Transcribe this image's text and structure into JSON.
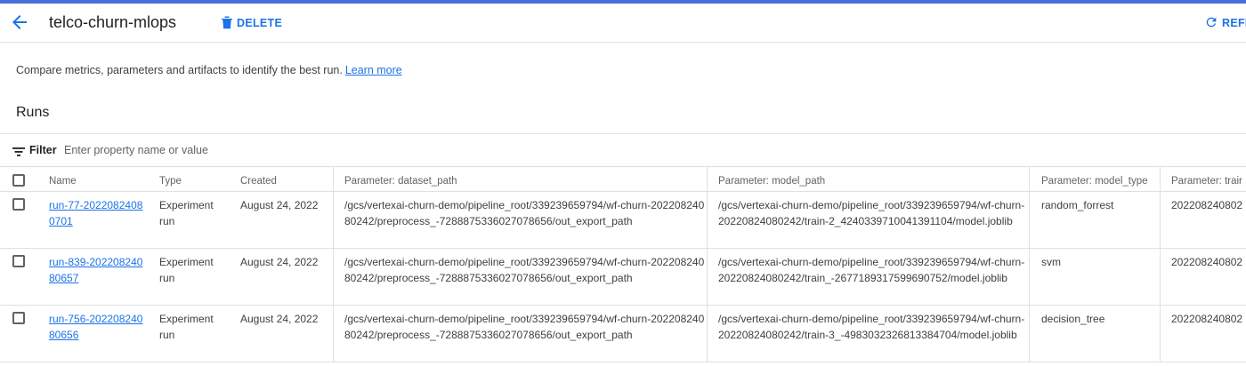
{
  "header": {
    "title": "telco-churn-mlops",
    "delete_label": "DELETE",
    "refresh_label": "REFR"
  },
  "description": {
    "text": "Compare metrics, parameters and artifacts to identify the best run.",
    "link": "Learn more"
  },
  "runs": {
    "heading": "Runs",
    "filter_label": "Filter",
    "filter_placeholder": "Enter property name or value"
  },
  "table": {
    "columns": {
      "name": "Name",
      "type": "Type",
      "created": "Created",
      "dataset_path": "Parameter: dataset_path",
      "model_path": "Parameter: model_path",
      "model_type": "Parameter: model_type",
      "train": "Parameter: trair"
    },
    "rows": [
      {
        "name": "run-77-20220824080701",
        "type": "Experiment run",
        "created": "August 24, 2022",
        "dataset_path": "/gcs/vertexai-churn-demo/pipeline_root/339239659794/wf-churn-20220824080242/preprocess_-7288875336027078656/out_export_path",
        "model_path": "/gcs/vertexai-churn-demo/pipeline_root/339239659794/wf-churn-20220824080242/train-2_4240339710041391104/model.joblib",
        "model_type": "random_forrest",
        "train": "202208240802"
      },
      {
        "name": "run-839-20220824080657",
        "type": "Experiment run",
        "created": "August 24, 2022",
        "dataset_path": "/gcs/vertexai-churn-demo/pipeline_root/339239659794/wf-churn-20220824080242/preprocess_-7288875336027078656/out_export_path",
        "model_path": "/gcs/vertexai-churn-demo/pipeline_root/339239659794/wf-churn-20220824080242/train_-2677189317599690752/model.joblib",
        "model_type": "svm",
        "train": "202208240802"
      },
      {
        "name": "run-756-20220824080656",
        "type": "Experiment run",
        "created": "August 24, 2022",
        "dataset_path": "/gcs/vertexai-churn-demo/pipeline_root/339239659794/wf-churn-20220824080242/preprocess_-7288875336027078656/out_export_path",
        "model_path": "/gcs/vertexai-churn-demo/pipeline_root/339239659794/wf-churn-20220824080242/train-3_-4983032326813384704/model.joblib",
        "model_type": "decision_tree",
        "train": "202208240802"
      }
    ]
  },
  "colors": {
    "accent": "#1a73e8",
    "top_bar": "#4a6fd9",
    "divider": "#e0e0e0"
  },
  "icons": [
    "arrow-back-icon",
    "trash-icon",
    "refresh-icon",
    "filter-icon",
    "checkbox-icon"
  ]
}
